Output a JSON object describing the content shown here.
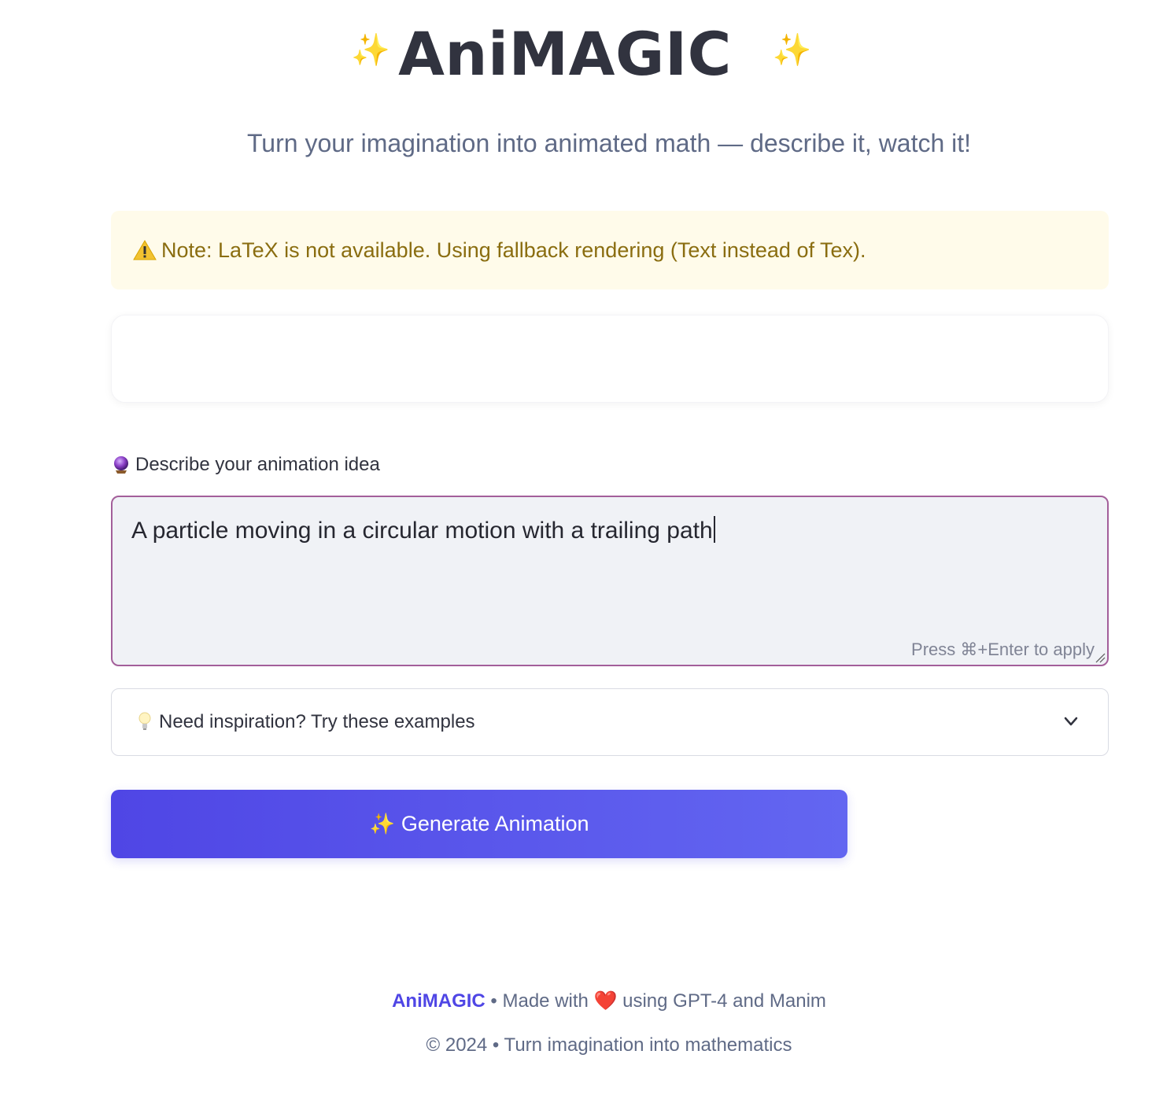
{
  "header": {
    "title": "AniMAGIC",
    "sparkle_left_icon": "sparkles-icon",
    "sparkle_right_icon": "sparkles-icon",
    "subtitle": "Turn your imagination into animated math — describe it, watch it!"
  },
  "warning": {
    "icon": "warning-icon",
    "text": "Note: LaTeX is not available. Using fallback rendering (Text instead of Tex).",
    "color": "#8a6d10",
    "background": "#fffbea"
  },
  "prompt": {
    "label": "Describe your animation idea",
    "label_icon": "crystal-ball-icon",
    "value": "A particle moving in a circular motion with a trailing path",
    "hint": "Press ⌘+Enter to apply",
    "border_color": "#a35f9a"
  },
  "examples": {
    "label": "Need inspiration? Try these examples",
    "icon": "lightbulb-icon"
  },
  "generate_button": {
    "label": "Generate Animation",
    "icon": "sparkles-icon",
    "color_start": "#4f46e5",
    "color_end": "#6366f1"
  },
  "footer": {
    "brand": "AniMAGIC",
    "made_with_prefix": " • Made with ",
    "heart": "❤️",
    "made_with_suffix": " using GPT-4 and Manim",
    "copyright": "© 2024 • Turn imagination into mathematics"
  }
}
